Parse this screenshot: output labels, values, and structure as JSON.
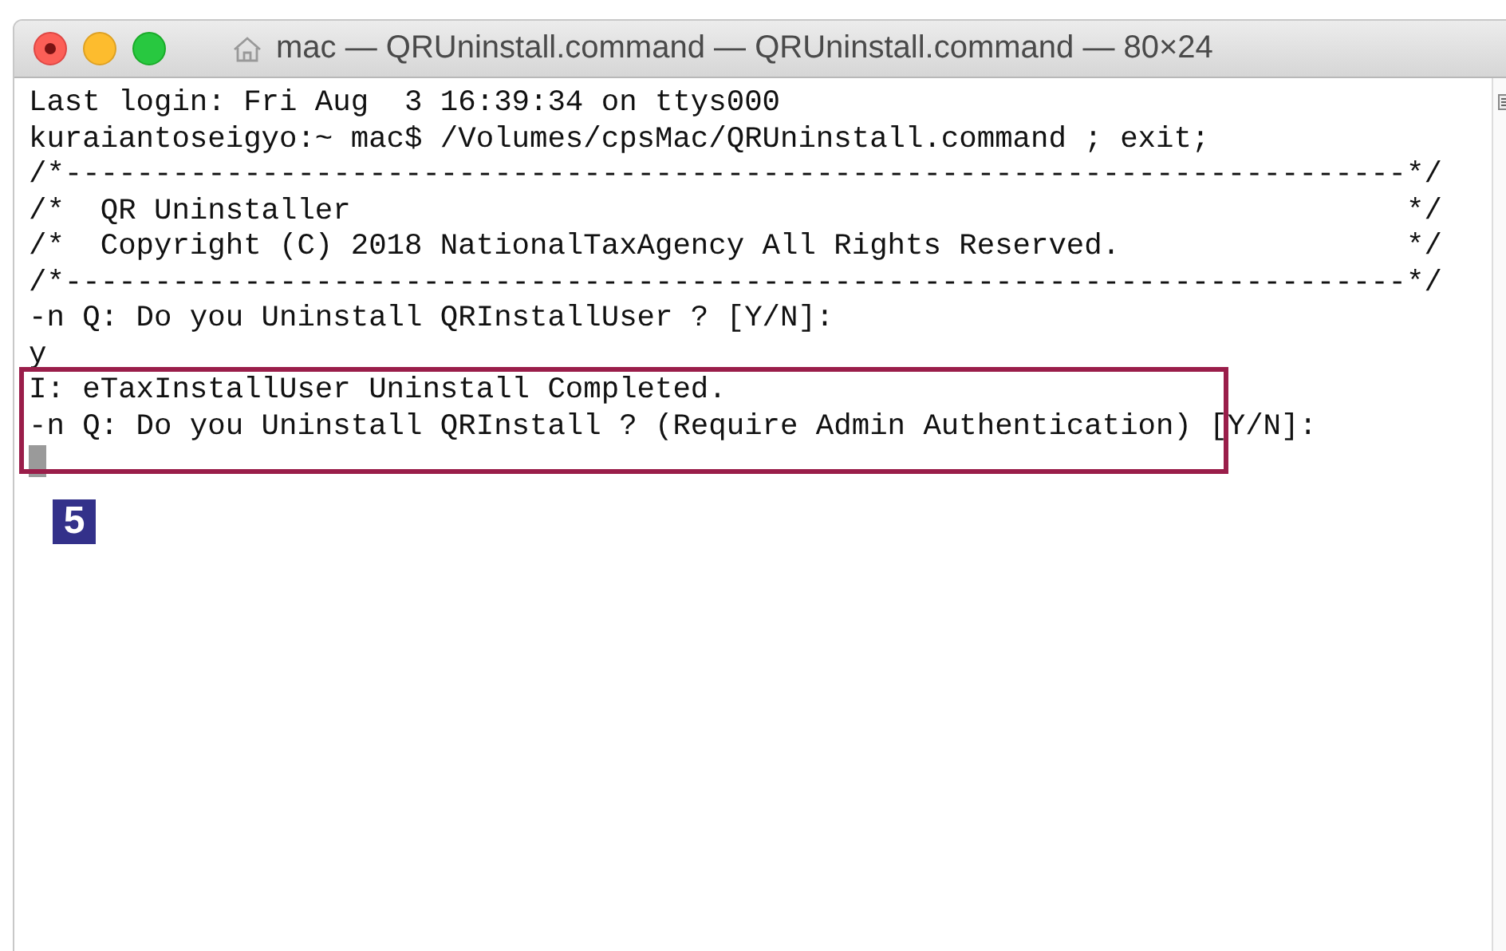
{
  "window": {
    "title": "mac — QRUninstall.command — QRUninstall.command — 80×24"
  },
  "terminal": {
    "lines": [
      "Last login: Fri Aug  3 16:39:34 on ttys000",
      "kuraiantoseigyo:~ mac$ /Volumes/cpsMac/QRUninstall.command ; exit;",
      "/*---------------------------------------------------------------------------*/",
      "/*  QR Uninstaller                                                           */",
      "/*  Copyright (C) 2018 NationalTaxAgency All Rights Reserved.                */",
      "/*---------------------------------------------------------------------------*/",
      "-n Q: Do you Uninstall QRInstallUser ? [Y/N]:",
      "y",
      "I: eTaxInstallUser Uninstall Completed.",
      "-n Q: Do you Uninstall QRInstall ? (Require Admin Authentication) [Y/N]:"
    ]
  },
  "annotation": {
    "label": "5"
  }
}
